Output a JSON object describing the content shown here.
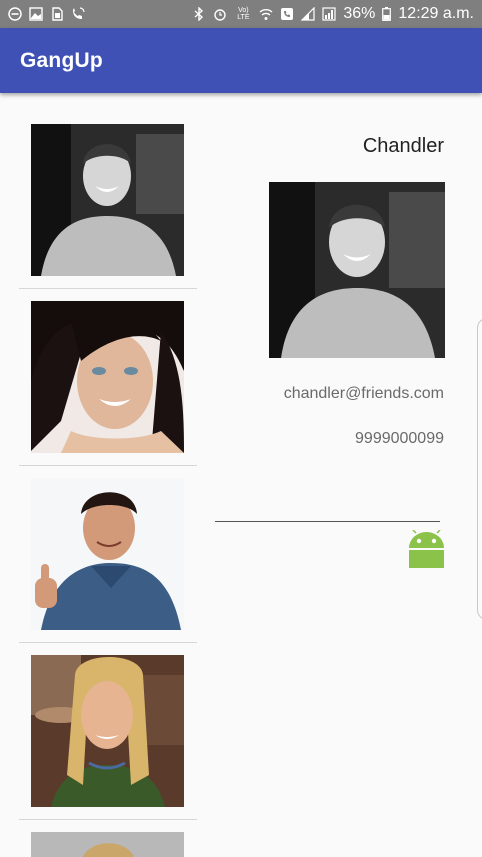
{
  "status_bar": {
    "battery": "36%",
    "time": "12:29 a.m.",
    "volte_label": "Vo) LTE"
  },
  "app_bar": {
    "title": "GangUp"
  },
  "contacts": [
    {
      "icon": "chandler-photo"
    },
    {
      "icon": "monica-photo"
    },
    {
      "icon": "ross-photo"
    },
    {
      "icon": "phoebe-photo"
    },
    {
      "icon": "partial-photo"
    }
  ],
  "detail": {
    "name": "Chandler",
    "email": "chandler@friends.com",
    "phone": "9999000099",
    "photo_icon": "chandler-photo"
  },
  "colors": {
    "app_bar": "#3f51b5",
    "status_bar": "#7f7f7f",
    "android_green": "#8bc34a"
  }
}
